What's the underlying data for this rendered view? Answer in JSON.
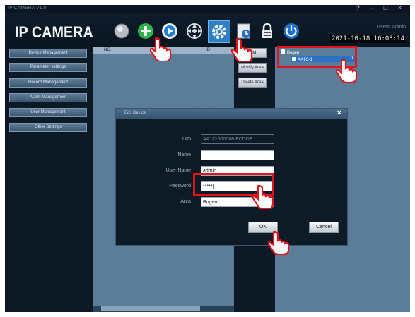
{
  "window": {
    "title": "IP CAMERA V1.0",
    "controls": "? – □ ×"
  },
  "header": {
    "logo": "IP CAMERA",
    "user": "Users: admin",
    "datetime": "2021-10-18 16:03:14"
  },
  "toolbar": {
    "items": [
      "camera-icon",
      "add-device-icon",
      "playback-icon",
      "ptz-icon",
      "settings-icon",
      "log-icon",
      "lock-icon",
      "power-icon"
    ],
    "selected": "settings-icon"
  },
  "sidebar": {
    "items": [
      "Device Management",
      "Parameter settings",
      "Record Management",
      "Alarm Management",
      "User Management",
      "Other Settings"
    ]
  },
  "device_list": {
    "columns": [
      "NO.",
      "",
      "ID"
    ]
  },
  "actions": {
    "add": "Add",
    "modify": "Modify Area",
    "delete": "Delete Area"
  },
  "tree": {
    "root": "Bogen",
    "child": "AA1C-1",
    "child_suffix": "0"
  },
  "dialog": {
    "title": "Edit Device",
    "close": "×",
    "fields": [
      {
        "label": "UID",
        "value": "AA1C-000068-FCDDE"
      },
      {
        "label": "Name",
        "value": ""
      },
      {
        "label": "User Name",
        "value": "admin"
      },
      {
        "label": "Password",
        "value": "*****|"
      },
      {
        "label": "Area",
        "value": "Bogen"
      }
    ],
    "ok": "OK",
    "cancel": "Cancel"
  },
  "colors": {
    "accent": "#2f7fc4",
    "highlight": "#e0141c",
    "panel": "#5c7d99"
  }
}
